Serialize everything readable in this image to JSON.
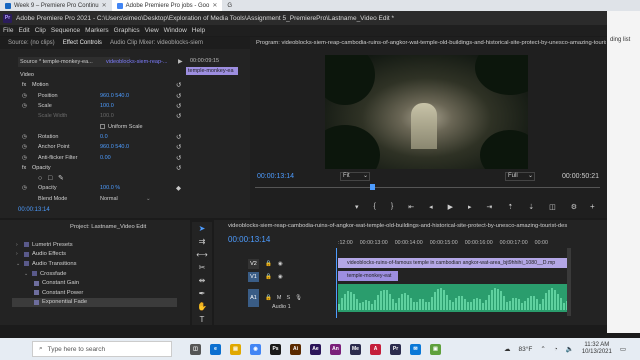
{
  "browser": {
    "tabs": [
      {
        "label": "Week 9 – Premiere Pro Continu",
        "color": "#1565c0",
        "active": false
      },
      {
        "label": "Adobe Premiere Pro jobs - Goo",
        "color": "#4285f4",
        "active": true
      },
      {
        "label": "G",
        "color": "#4285f4",
        "active": false
      }
    ],
    "reading_list": "ding list"
  },
  "titlebar": {
    "app_badge": "Pr",
    "title": "Adobe Premiere Pro 2021 - C:\\Users\\simeo\\Desktop\\Exploration of Media Tools\\Assignment 5_PremierePro\\Lastname_Video Edit *"
  },
  "menu": [
    "File",
    "Edit",
    "Clip",
    "Sequence",
    "Markers",
    "Graphics",
    "View",
    "Window",
    "Help"
  ],
  "effect_controls": {
    "tabs": [
      "Source: (no clips)",
      "Effect Controls",
      "Audio Clip Mixer: videoblocks-siem"
    ],
    "source_select": "Source * temple-monkey-ea...",
    "clip_name": "videoblocks-siem-reap-...",
    "timecode_top": "00:00:09:15",
    "mini_clip": "temple-monkey-ea",
    "section_video": "Video",
    "rows": [
      {
        "label": "Motion",
        "value": "",
        "kind": "section"
      },
      {
        "label": "Position",
        "value": "960.0     540.0",
        "kind": "prop"
      },
      {
        "label": "Scale",
        "value": "100.0",
        "kind": "prop"
      },
      {
        "label": "Scale Width",
        "value": "100.0",
        "kind": "dim"
      },
      {
        "label": "Uniform Scale",
        "value": "",
        "kind": "check"
      },
      {
        "label": "Rotation",
        "value": "0.0",
        "kind": "prop"
      },
      {
        "label": "Anchor Point",
        "value": "960.0     540.0",
        "kind": "prop"
      },
      {
        "label": "Anti-flicker Filter",
        "value": "0.00",
        "kind": "prop"
      },
      {
        "label": "Opacity",
        "value": "",
        "kind": "section"
      },
      {
        "label": "",
        "value": "",
        "kind": "masks"
      },
      {
        "label": "Opacity",
        "value": "100.0 %",
        "kind": "prop"
      },
      {
        "label": "Blend Mode",
        "value": "Normal",
        "kind": "select"
      }
    ],
    "footer_timecode": "00:00:13:14"
  },
  "program_monitor": {
    "title": "Program: videoblocks-siem-reap-cambodia-ruins-of-angkor-wat-temple-old-buildings-and-historical-site-protect-by-unesco-amazing-tourist-d",
    "timecode": "00:00:13:14",
    "fit": "Fit",
    "resolution": "Full",
    "duration": "00:00:50:21",
    "playhead_fraction": 0.34
  },
  "project": {
    "title": "Project: Lastname_Video Edit",
    "items": [
      {
        "label": "Lumetri Presets",
        "indent": 1,
        "caret": "›",
        "selected": false
      },
      {
        "label": "Audio Effects",
        "indent": 1,
        "caret": "›",
        "selected": false
      },
      {
        "label": "Audio Transitions",
        "indent": 1,
        "caret": "⌄",
        "selected": false
      },
      {
        "label": "Crossfade",
        "indent": 2,
        "caret": "⌄",
        "selected": false
      },
      {
        "label": "Constant Gain",
        "indent": 3,
        "caret": "",
        "selected": false
      },
      {
        "label": "Constant Power",
        "indent": 3,
        "caret": "",
        "selected": false
      },
      {
        "label": "Exponential Fade",
        "indent": 3,
        "caret": "",
        "selected": true
      }
    ]
  },
  "tools": [
    "selection-tool",
    "track-select-tool",
    "ripple-edit-tool",
    "razor-tool",
    "slip-tool",
    "pen-tool",
    "hand-tool",
    "type-tool"
  ],
  "timeline": {
    "title": "videoblocks-siem-reap-cambodia-ruins-of-angkor-wat-temple-old-buildings-and-historical-site-protect-by-unesco-amazing-tourist-des",
    "timecode": "00:00:13:14",
    "ruler": [
      ":12:00",
      "00:00:13:00",
      "00:00:14:00",
      "00:00:15:00",
      "00:00:16:00",
      "00:00:17:00",
      "00:00"
    ],
    "tracks": {
      "v2": "V2",
      "v1": "V1",
      "a1": "A1",
      "a1_name": "Audio 1"
    },
    "clip_v2": "videoblocks-ruins-of-famous temple in cambodian angkor-wat-area_bjt9hhihi_1080__D.mp",
    "clip_v1": "temple-monkey-eat"
  },
  "taskbar": {
    "search_placeholder": "Type here to search",
    "weather": "83°F",
    "time": "11:32 AM",
    "date": "10/13/2021"
  },
  "colors": {
    "accent_blue": "#4d9cff",
    "clip_purple": "#b4a7e6",
    "audio_green": "#2a9d6d"
  }
}
